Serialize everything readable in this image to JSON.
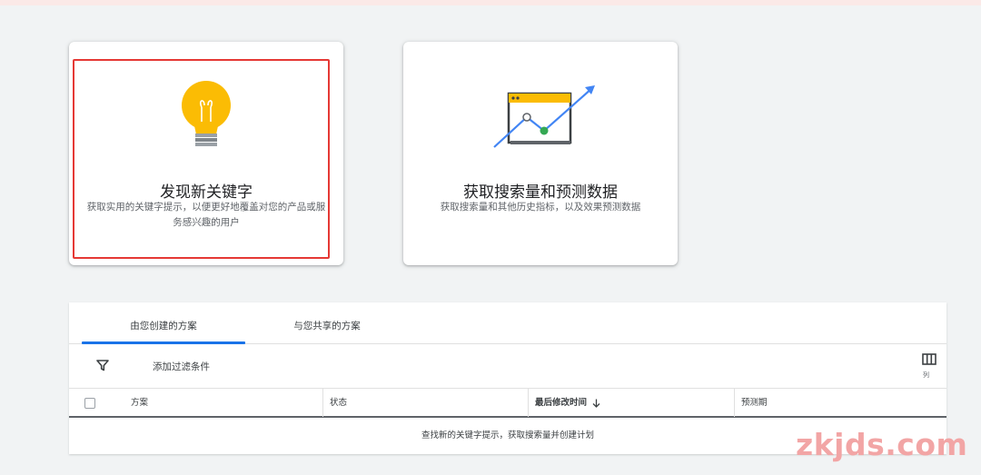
{
  "cards": [
    {
      "title": "发现新关键字",
      "description": "获取实用的关键字提示，以便更好地覆盖对您的产品或服务感兴趣的用户",
      "icon": "lightbulb-icon",
      "highlighted": true
    },
    {
      "title": "获取搜索量和预测数据",
      "description": "获取搜索量和其他历史指标，以及效果预测数据",
      "icon": "trend-chart-icon",
      "highlighted": false
    }
  ],
  "tabs": [
    {
      "label": "由您创建的方案",
      "active": true
    },
    {
      "label": "与您共享的方案",
      "active": false
    }
  ],
  "filter": {
    "label": "添加过滤条件",
    "icon": "filter-icon"
  },
  "columns_button": {
    "label": "列",
    "icon": "columns-icon"
  },
  "table": {
    "headers": [
      "方案",
      "状态",
      "最后修改时间",
      "预测期"
    ],
    "sorted_column": "最后修改时间",
    "empty_message": "查找新的关键字提示，获取搜索量并创建计划"
  },
  "watermark": "zkjds.com",
  "colors": {
    "accent": "#1a73e8",
    "highlight_border": "#e53935",
    "bulb": "#fbbc04",
    "trend_green": "#34a853",
    "arrow_blue": "#4285f4"
  }
}
